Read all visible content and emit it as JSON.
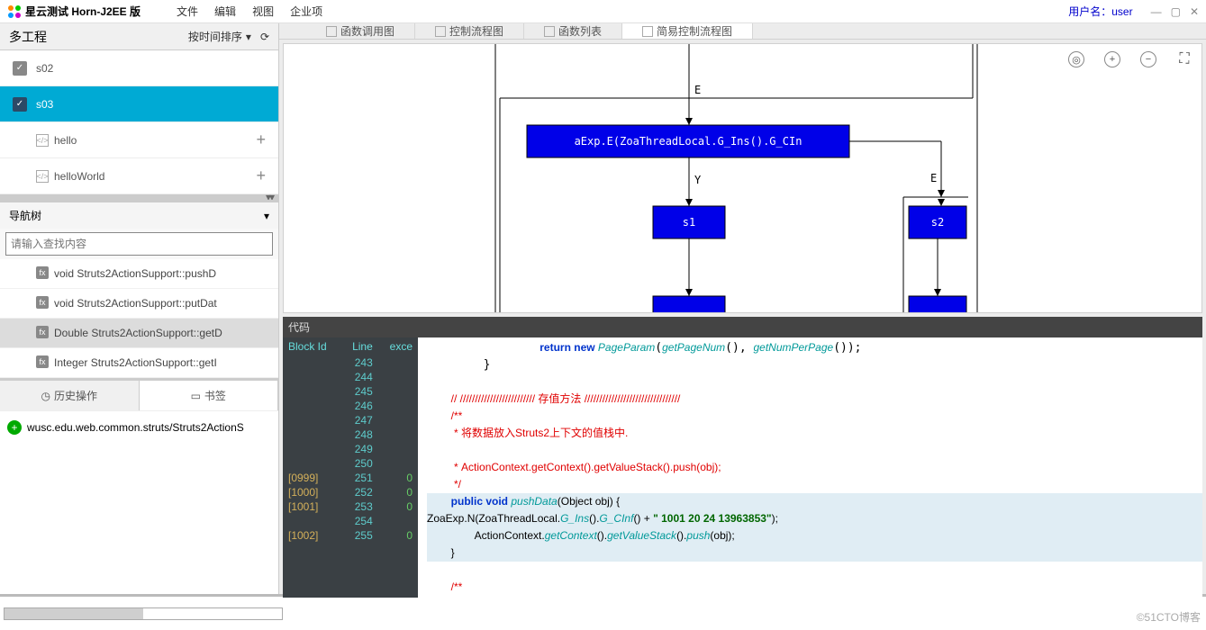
{
  "app": {
    "title": "星云测试 Horn-J2EE 版"
  },
  "menu": {
    "file": "文件",
    "edit": "编辑",
    "view": "视图",
    "enterprise": "企业项"
  },
  "user": {
    "label": "用户名：",
    "name": "user"
  },
  "sidebar": {
    "header": "多工程",
    "sortby": "按时间排序",
    "projects": [
      {
        "name": "s02",
        "type": "toggle",
        "selected": false
      },
      {
        "name": "s03",
        "type": "toggle",
        "selected": true
      },
      {
        "name": "hello",
        "type": "code",
        "selected": false,
        "plus": true
      },
      {
        "name": "helloWorld",
        "type": "code",
        "selected": false,
        "plus": true
      }
    ],
    "navtree": {
      "title": "导航树",
      "search_placeholder": "请输入查找内容",
      "items": [
        {
          "label": "void Struts2ActionSupport::pushD",
          "sel": false
        },
        {
          "label": "void Struts2ActionSupport::putDat",
          "sel": false
        },
        {
          "label": "Double Struts2ActionSupport::getD",
          "sel": true
        },
        {
          "label": "Integer Struts2ActionSupport::getI",
          "sel": false
        }
      ]
    },
    "bottomtabs": {
      "history": "历史操作",
      "bookmark": "书签"
    },
    "path": "wusc.edu.web.common.struts/Struts2ActionS"
  },
  "tabs": [
    {
      "label": "函数调用图",
      "active": false
    },
    {
      "label": "控制流程图",
      "active": false
    },
    {
      "label": "函数列表",
      "active": false
    },
    {
      "label": "简易控制流程图",
      "active": true
    }
  ],
  "diagram": {
    "top_node": "aExp.E(ZoaThreadLocal.G_Ins().G_CIn",
    "edge_e": "E",
    "edge_y": "Y",
    "s1": "s1",
    "s2": "s2"
  },
  "code": {
    "label": "代码",
    "gutter_headers": {
      "block": "Block Id",
      "line": "Line",
      "exec": "exce"
    },
    "gutter_rows": [
      {
        "block": "",
        "line": "243",
        "exec": ""
      },
      {
        "block": "",
        "line": "244",
        "exec": ""
      },
      {
        "block": "",
        "line": "245",
        "exec": ""
      },
      {
        "block": "",
        "line": "246",
        "exec": ""
      },
      {
        "block": "",
        "line": "247",
        "exec": ""
      },
      {
        "block": "",
        "line": "248",
        "exec": ""
      },
      {
        "block": "",
        "line": "249",
        "exec": ""
      },
      {
        "block": "",
        "line": "250",
        "exec": ""
      },
      {
        "block": "[0999]",
        "line": "251",
        "exec": "0"
      },
      {
        "block": "[1000]",
        "line": "252",
        "exec": "0"
      },
      {
        "block": "[1001]",
        "line": "253",
        "exec": "0"
      },
      {
        "block": "",
        "line": "254",
        "exec": ""
      },
      {
        "block": "[1002]",
        "line": "255",
        "exec": "0"
      }
    ],
    "lines": {
      "l243": {
        "pre": "                ",
        "kw1": "return new ",
        "type": "PageParam",
        "rest": "(",
        "f1": "getPageNum",
        "mid": "(), ",
        "f2": "getNumPerPage",
        "end": "());"
      },
      "l244": "        }",
      "l245": "",
      "l246": "        // ///////////////////////// 存值方法 ////////////////////////////////",
      "l247": "        /**",
      "l248": "         * 将数据放入Struts2上下文的值栈中.<br/>",
      "l249": "         * ActionContext.getContext().getValueStack().push(obj);",
      "l250": "         */",
      "l251": {
        "pre": "        ",
        "kw1": "public ",
        "kw2": "void ",
        "fn": "pushData",
        "rest": "(Object obj) {"
      },
      "l252": {
        "pre": "ZoaExp.N(ZoaThreadLocal.",
        "f1": "G_Ins",
        "mid": "().",
        "f2": "G_CInf",
        "mid2": "() + ",
        "str": "\" 1001 20 24 13963853\"",
        "end": ");"
      },
      "l253": {
        "pre": "                ActionContext.",
        "f1": "getContext",
        "mid": "().",
        "f2": "getValueStack",
        "mid2": "().",
        "f3": "push",
        "end": "(obj);"
      },
      "l254": "        }",
      "l255": "",
      "l256": "        /**"
    }
  },
  "watermark": "©51CTO博客"
}
